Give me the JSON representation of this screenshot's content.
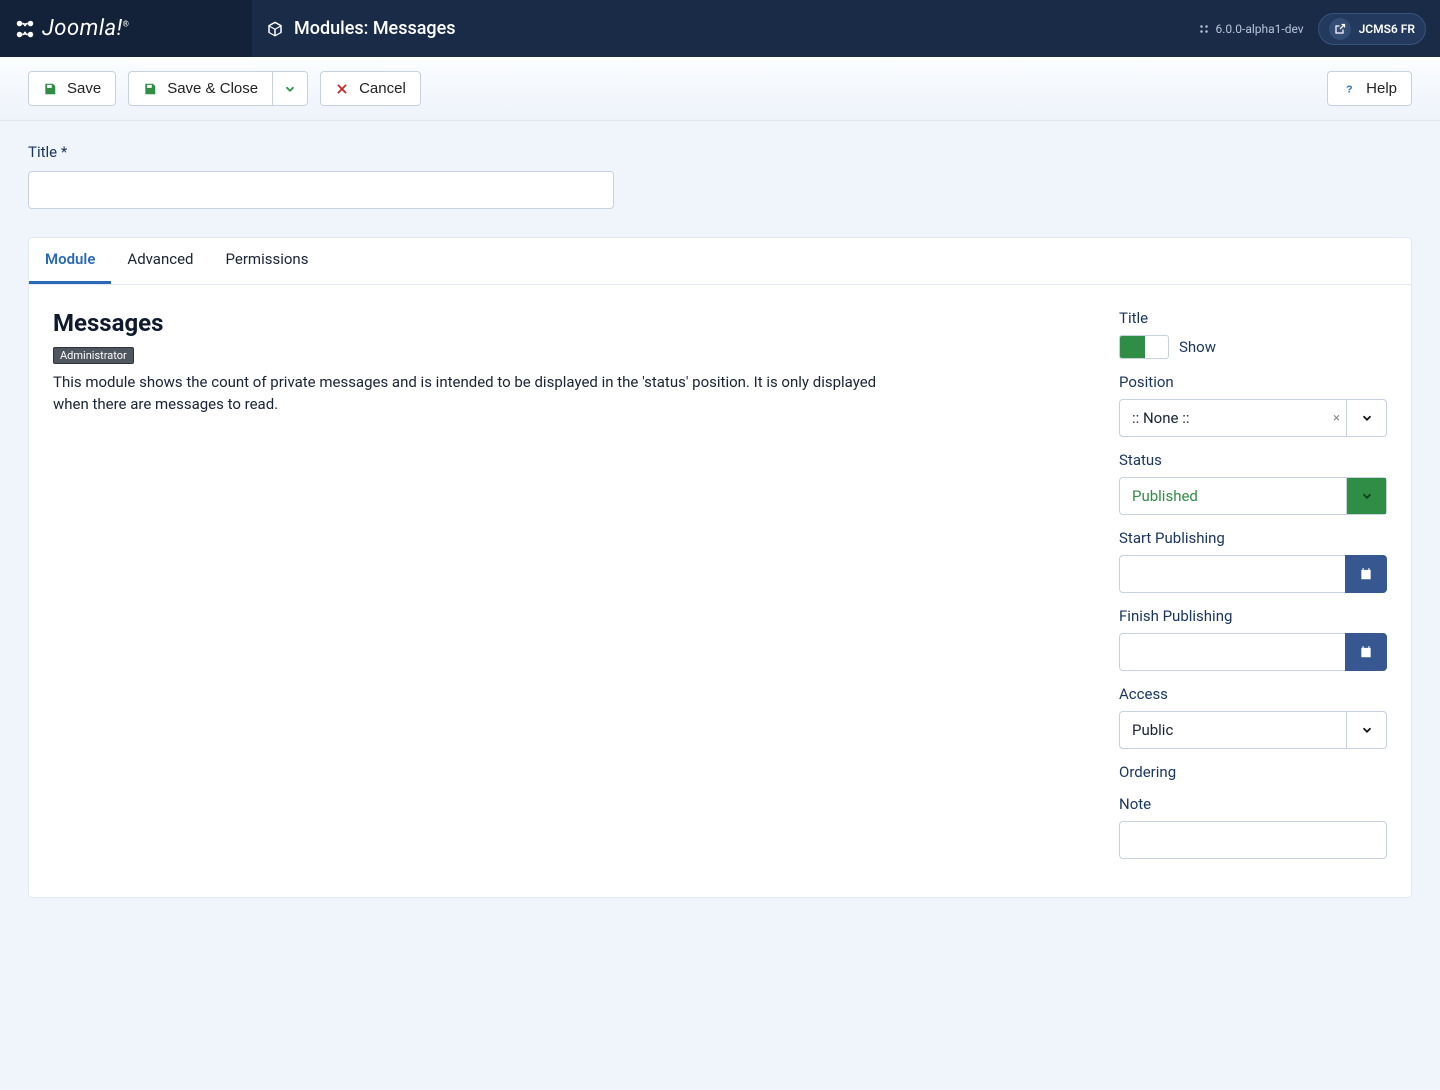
{
  "brand": "Joomla!",
  "header": {
    "title": "Modules: Messages",
    "version": "6.0.0-alpha1-dev",
    "site": "JCMS6 FR"
  },
  "toolbar": {
    "save": "Save",
    "save_close": "Save & Close",
    "cancel": "Cancel",
    "help": "Help"
  },
  "title_field": {
    "label": "Title *",
    "value": ""
  },
  "tabs": [
    "Module",
    "Advanced",
    "Permissions"
  ],
  "module": {
    "heading": "Messages",
    "chip": "Administrator",
    "description": "This module shows the count of private messages and is intended to be displayed in the 'status' position. It is only displayed when there are messages to read."
  },
  "side": {
    "title_label": "Title",
    "title_toggle_text": "Show",
    "position_label": "Position",
    "position_value": ":: None ::",
    "status_label": "Status",
    "status_value": "Published",
    "start_pub_label": "Start Publishing",
    "start_pub_value": "",
    "finish_pub_label": "Finish Publishing",
    "finish_pub_value": "",
    "access_label": "Access",
    "access_value": "Public",
    "ordering_label": "Ordering",
    "note_label": "Note",
    "note_value": ""
  }
}
